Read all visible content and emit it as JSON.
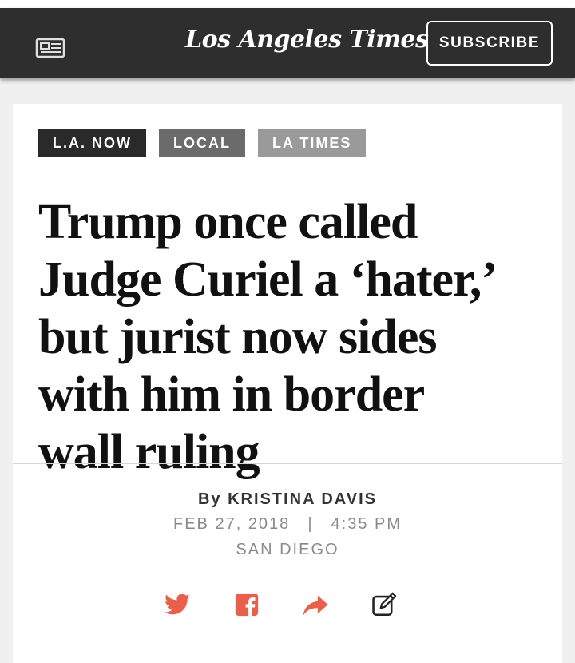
{
  "header": {
    "logo": "Los Angeles Times",
    "subscribe_label": "SUBSCRIBE",
    "icons": {
      "menu": "newspaper-icon"
    }
  },
  "tags": [
    "L.A. NOW",
    "LOCAL",
    "LA TIMES"
  ],
  "article": {
    "headline": "Trump once called Judge Curiel a ‘hater,’ but jurist now sides with him in border wall ruling",
    "byline_prefix": "By",
    "author": "KRISTINA DAVIS",
    "date": "FEB 27, 2018",
    "separator": "|",
    "time": "4:35 PM",
    "location": "SAN DIEGO"
  },
  "share": {
    "icons": [
      "twitter-icon",
      "facebook-icon",
      "share-icon",
      "edit-icon"
    ]
  },
  "colors": {
    "topbar": "#2e2e2e",
    "share_accent": "#e8604c",
    "tag_dark": "#2a2a2a",
    "tag_mid": "#6b6b6b",
    "tag_light": "#9a9a9a"
  }
}
